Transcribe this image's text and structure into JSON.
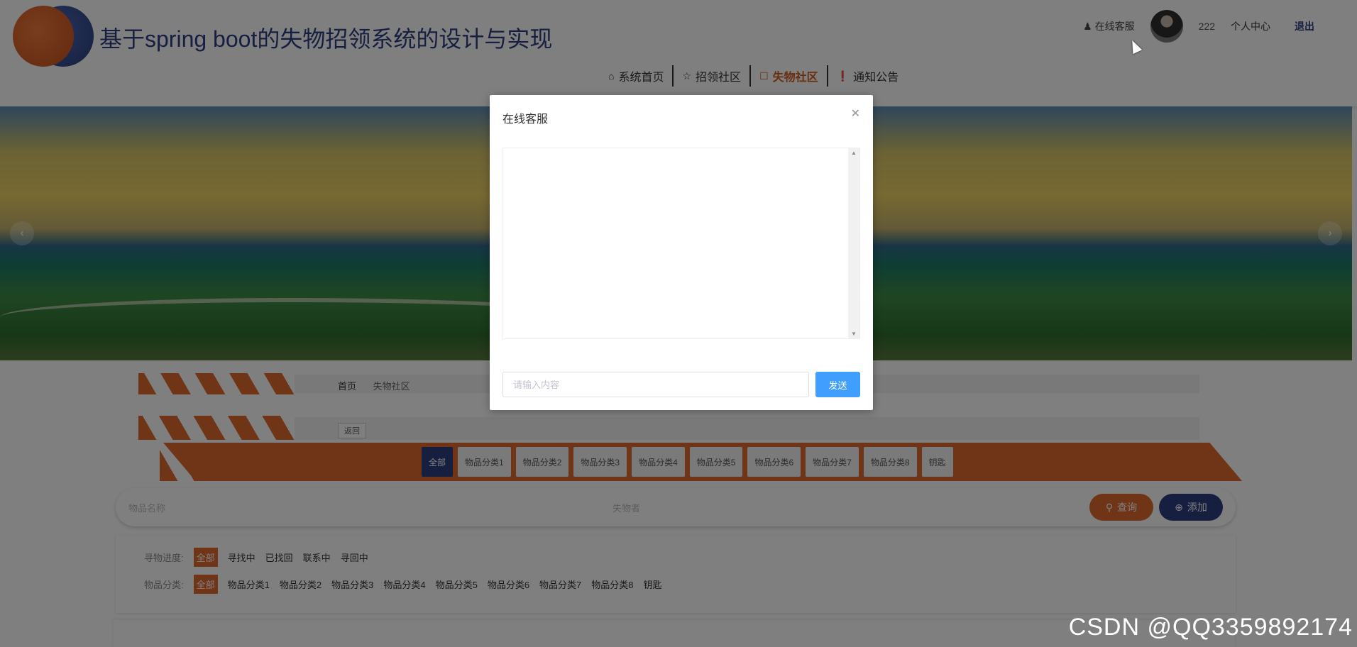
{
  "header": {
    "title": "基于spring boot的失物招领系统的设计与实现",
    "online_service": "在线客服",
    "username": "222",
    "profile": "个人中心",
    "logout": "退出"
  },
  "nav": {
    "items": [
      {
        "label": "系统首页",
        "icon": "home-icon"
      },
      {
        "label": "招领社区",
        "icon": "star-icon"
      },
      {
        "label": "失物社区",
        "icon": "bag-icon",
        "active": true
      },
      {
        "label": "通知公告",
        "icon": "alert-icon"
      }
    ]
  },
  "breadcrumb": {
    "home": "首页",
    "current": "失物社区"
  },
  "back_label": "返回",
  "categories": [
    "全部",
    "物品分类1",
    "物品分类2",
    "物品分类3",
    "物品分类4",
    "物品分类5",
    "物品分类6",
    "物品分类7",
    "物品分类8",
    "钥匙"
  ],
  "search": {
    "name_placeholder": "物品名称",
    "owner_placeholder": "失物者",
    "query": "查询",
    "add": "添加"
  },
  "filters": {
    "progress_label": "寻物进度:",
    "progress_options": [
      "全部",
      "寻找中",
      "已找回",
      "联系中",
      "寻回中"
    ],
    "category_label": "物品分类:",
    "category_options": [
      "全部",
      "物品分类1",
      "物品分类2",
      "物品分类3",
      "物品分类4",
      "物品分类5",
      "物品分类6",
      "物品分类7",
      "物品分类8",
      "钥匙"
    ]
  },
  "dialog": {
    "title": "在线客服",
    "input_placeholder": "请输入内容",
    "send": "发送"
  },
  "watermark": "CSDN @QQ3359892174",
  "colors": {
    "primary": "#2f3e83",
    "accent": "#e06a2d",
    "send": "#409eff"
  }
}
